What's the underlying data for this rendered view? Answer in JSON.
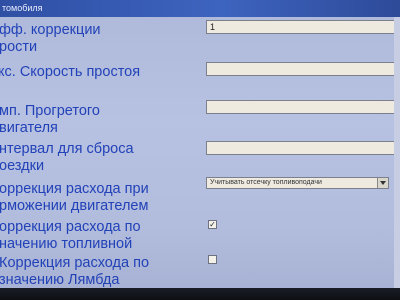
{
  "window": {
    "title": "томобиля"
  },
  "rows": [
    {
      "label": "фф. коррекции\nрости",
      "value": "1"
    },
    {
      "label": "кс. Скорость простоя",
      "value": ""
    },
    {
      "label": "мп. Прогретого\nвигателя",
      "value": ""
    },
    {
      "label": "нтервал для сброса\nоездки",
      "value": ""
    },
    {
      "label": "оррекция расхода при\nрможении двигателем",
      "select_value": "Учитывать отсечку топливоподачи"
    },
    {
      "label": "оррекция расхода по\nначению топливной",
      "checked": "✓"
    },
    {
      "label": "Коррекция расхода по\nзначению Лямбда",
      "checked": ""
    }
  ]
}
